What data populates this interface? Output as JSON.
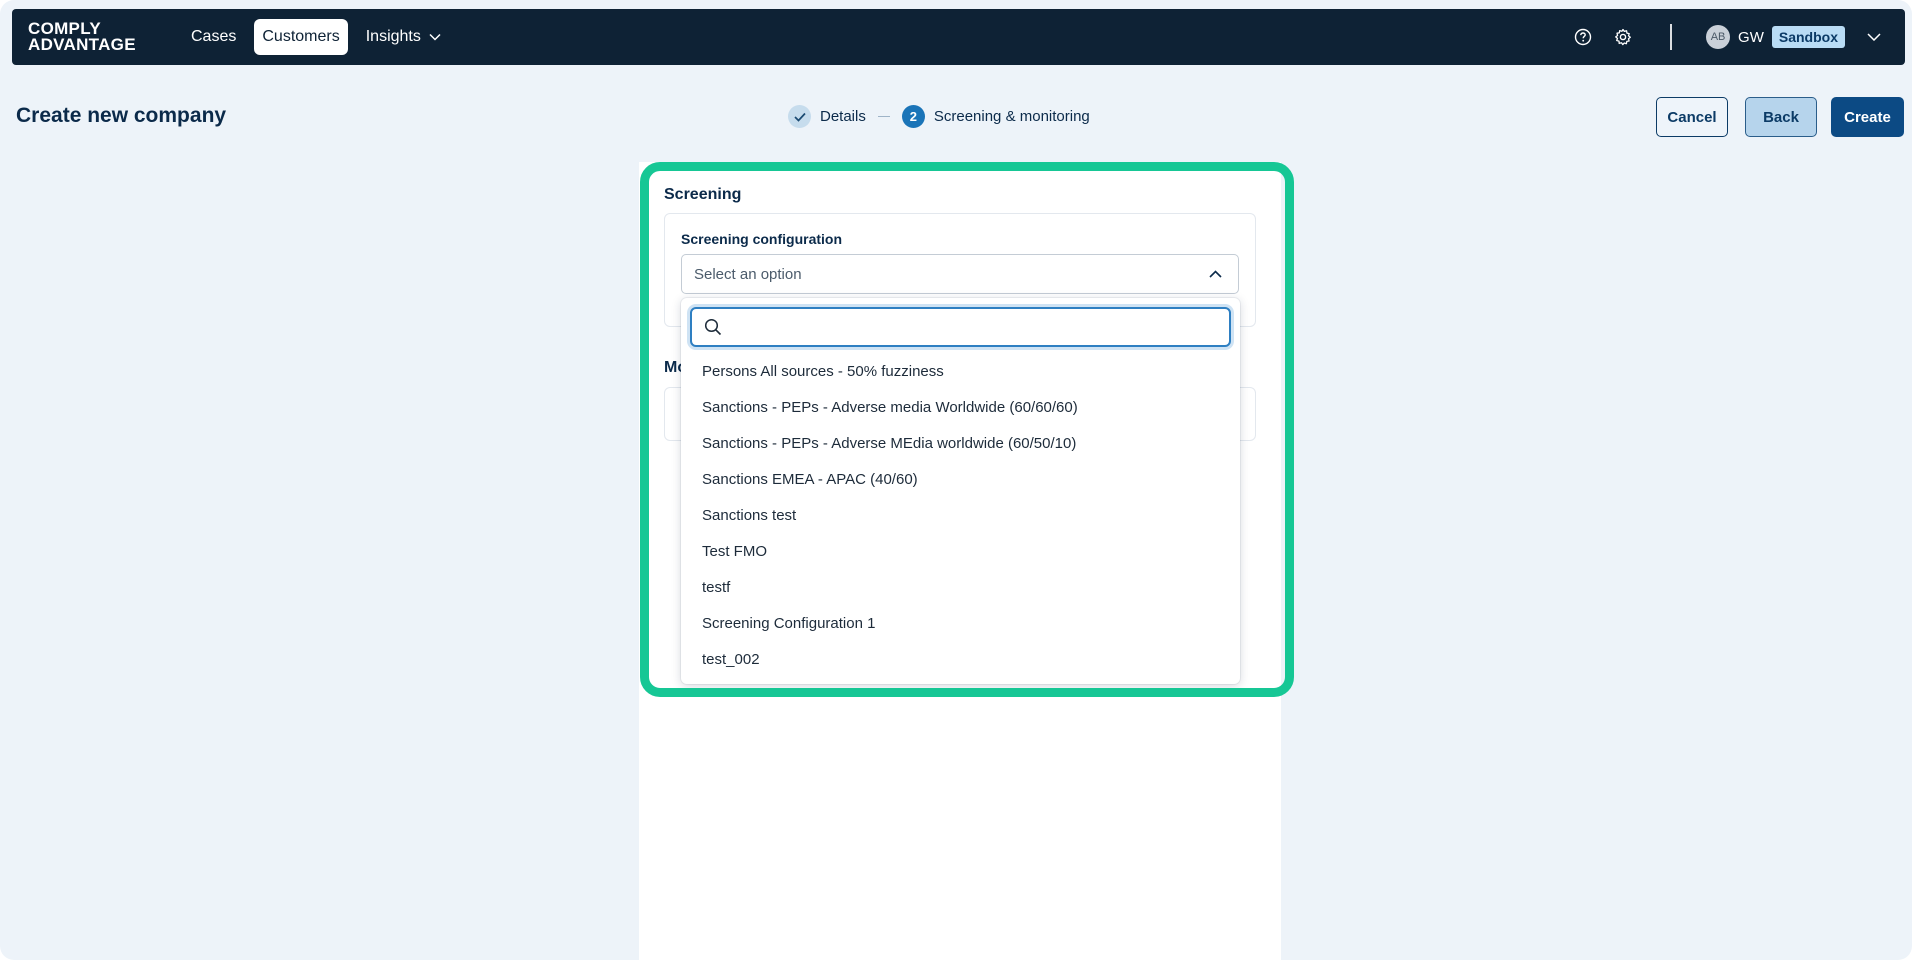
{
  "brand": {
    "line1": "COMPLY",
    "line2": "ADVANTAGE"
  },
  "nav": {
    "items": [
      {
        "label": "Cases"
      },
      {
        "label": "Customers"
      },
      {
        "label": "Insights"
      }
    ],
    "user_initials_avatar": "AB",
    "user_initials": "GW",
    "environment_badge": "Sandbox"
  },
  "page": {
    "title": "Create new company",
    "steps": [
      {
        "number": "1",
        "label": "Details",
        "state": "done"
      },
      {
        "number": "2",
        "label": "Screening & monitoring",
        "state": "current"
      }
    ],
    "buttons": {
      "cancel": "Cancel",
      "back": "Back",
      "create": "Create"
    }
  },
  "screening": {
    "section_title": "Screening",
    "field_label": "Screening configuration",
    "select_placeholder": "Select an option",
    "search_value": "",
    "options": [
      "Persons All sources - 50% fuzziness",
      "Sanctions - PEPs - Adverse media Worldwide (60/60/60)",
      "Sanctions - PEPs - Adverse MEdia worldwide (60/50/10)",
      "Sanctions EMEA - APAC (40/60)",
      "Sanctions test",
      "Test FMO",
      "testf",
      "Screening Configuration 1",
      "test_002"
    ]
  },
  "monitoring": {
    "section_title_partial": "Mo"
  },
  "colors": {
    "nav_bg": "#0e2235",
    "page_bg": "#edf3f9",
    "primary": "#0c4a84",
    "highlight": "#16c795",
    "badge_bg": "#b9dcf5"
  }
}
